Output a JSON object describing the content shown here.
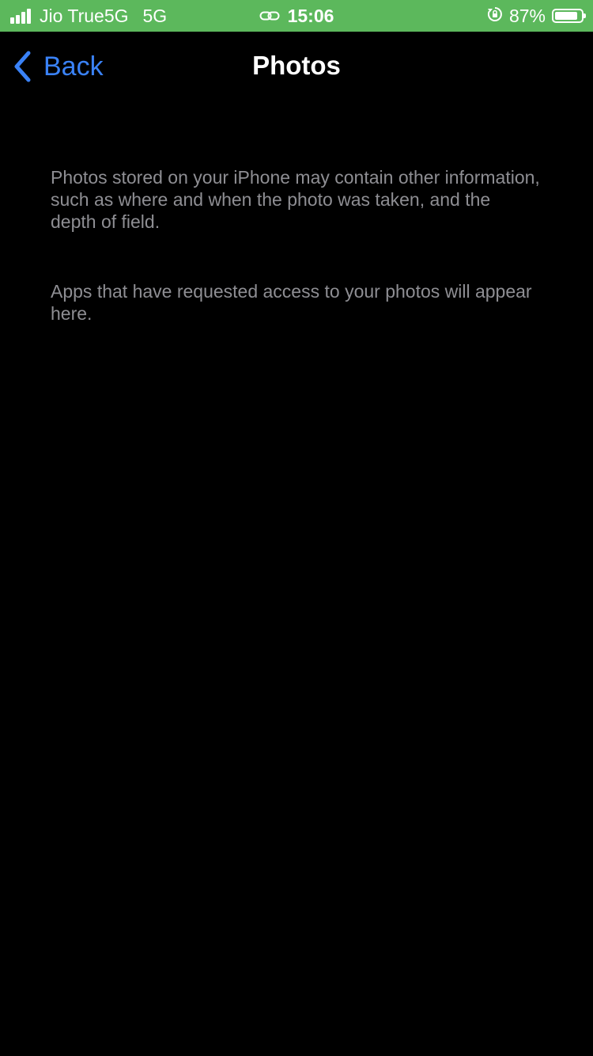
{
  "status_bar": {
    "carrier": "Jio True5G",
    "network": "5G",
    "time": "15:06",
    "battery_percent": "87%",
    "battery_level": 0.87,
    "background_color": "#5cb85c",
    "icons": [
      "signal-icon",
      "link-icon",
      "orientation-lock-icon",
      "battery-icon"
    ]
  },
  "nav": {
    "back_label": "Back",
    "title": "Photos",
    "accent_color": "#3a82f7"
  },
  "content": {
    "paragraphs": [
      "Photos stored on your iPhone may contain other information, such as where and when the photo was taken, and the depth of field.",
      "Apps that have requested access to your photos will appear here."
    ],
    "text_color": "#8e8e93"
  }
}
